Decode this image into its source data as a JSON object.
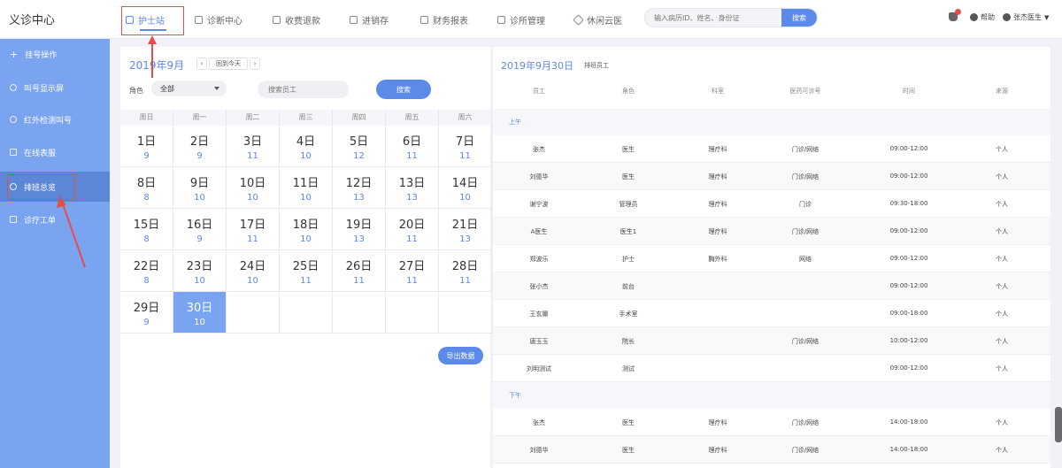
{
  "app": {
    "title": "义诊中心"
  },
  "nav": [
    {
      "label": "护士站",
      "icon": "shield-icon"
    },
    {
      "label": "诊断中心",
      "icon": "gear-icon"
    },
    {
      "label": "收费退款",
      "icon": "wallet-icon"
    },
    {
      "label": "进销存",
      "icon": "box-icon"
    },
    {
      "label": "财务报表",
      "icon": "chart-icon"
    },
    {
      "label": "诊所管理",
      "icon": "clinic-icon"
    },
    {
      "label": "休闲云医",
      "icon": "diamond-icon"
    }
  ],
  "search": {
    "placeholder": "输入病历ID、姓名、身份证",
    "button": "搜索"
  },
  "top_right": {
    "help": "帮助",
    "user": "张杰医生"
  },
  "sidebar": [
    {
      "label": "挂号操作"
    },
    {
      "label": "叫号显示屏"
    },
    {
      "label": "红外检测叫号"
    },
    {
      "label": "在线表服"
    },
    {
      "label": "排班总览"
    },
    {
      "label": "诊疗工单"
    }
  ],
  "calendar": {
    "month_title": "2019年9月",
    "prev": "‹",
    "today_btn": "回到今天",
    "next": "›",
    "role_label": "角色",
    "role_value": "全部",
    "name_placeholder": "搜索员工",
    "search_btn": "搜索",
    "weekdays": [
      "周日",
      "周一",
      "周二",
      "周三",
      "周四",
      "周五",
      "周六"
    ],
    "days": [
      {
        "day": "1日",
        "count": "9"
      },
      {
        "day": "2日",
        "count": "9"
      },
      {
        "day": "3日",
        "count": "11"
      },
      {
        "day": "4日",
        "count": "10"
      },
      {
        "day": "5日",
        "count": "12"
      },
      {
        "day": "6日",
        "count": "11"
      },
      {
        "day": "7日",
        "count": "11"
      },
      {
        "day": "8日",
        "count": "8"
      },
      {
        "day": "9日",
        "count": "10"
      },
      {
        "day": "10日",
        "count": "10"
      },
      {
        "day": "11日",
        "count": "10"
      },
      {
        "day": "12日",
        "count": "13"
      },
      {
        "day": "13日",
        "count": "13"
      },
      {
        "day": "14日",
        "count": "10"
      },
      {
        "day": "15日",
        "count": "8"
      },
      {
        "day": "16日",
        "count": "9"
      },
      {
        "day": "17日",
        "count": "11"
      },
      {
        "day": "18日",
        "count": "10"
      },
      {
        "day": "19日",
        "count": "13"
      },
      {
        "day": "20日",
        "count": "11"
      },
      {
        "day": "21日",
        "count": "13"
      },
      {
        "day": "22日",
        "count": "8"
      },
      {
        "day": "23日",
        "count": "10"
      },
      {
        "day": "24日",
        "count": "10"
      },
      {
        "day": "25日",
        "count": "11"
      },
      {
        "day": "26日",
        "count": "11"
      },
      {
        "day": "27日",
        "count": "11"
      },
      {
        "day": "28日",
        "count": "11"
      },
      {
        "day": "29日",
        "count": "9"
      },
      {
        "day": "30日",
        "count": "10"
      }
    ],
    "selected_day": "30日",
    "export_btn": "导出数据"
  },
  "schedule": {
    "title": "2019年9月30日",
    "subtitle": "排班员工",
    "columns": [
      "员工",
      "角色",
      "科室",
      "医药可诊号",
      "时间",
      "来源"
    ],
    "sections": [
      {
        "label": "上午",
        "rows": [
          [
            "张杰",
            "医生",
            "理疗科",
            "门诊/网络",
            "09:00-12:00",
            "个人"
          ],
          [
            "刘德华",
            "医生",
            "理疗科",
            "门诊/网络",
            "09:00-12:00",
            "个人"
          ],
          [
            "谢宁波",
            "管理员",
            "理疗科",
            "门诊",
            "09:30-18:00",
            "个人"
          ],
          [
            "A医生",
            "医生1",
            "理疗科",
            "门诊/网络",
            "09:00-12:00",
            "个人"
          ],
          [
            "郑波乐",
            "护士",
            "胸外科",
            "网络",
            "09:00-12:00",
            "个人"
          ],
          [
            "张小杰",
            "前台",
            "",
            "",
            "09:00-12:00",
            "个人"
          ],
          [
            "王玄娜",
            "手术室",
            "",
            "",
            "09:00-18:00",
            "个人"
          ],
          [
            "唐玉玉",
            "院长",
            "",
            "门诊/网络",
            "10:00-12:00",
            "个人"
          ],
          [
            "刘明测试",
            "测试",
            "",
            "",
            "09:00-12:00",
            "个人"
          ]
        ]
      },
      {
        "label": "下午",
        "rows": [
          [
            "张杰",
            "医生",
            "理疗科",
            "门诊/网络",
            "14:00-18:00",
            "个人"
          ],
          [
            "刘德华",
            "医生",
            "理疗科",
            "门诊/网络",
            "14:00-18:00",
            "个人"
          ]
        ]
      }
    ]
  },
  "colors": {
    "accent": "#5b8ae8",
    "sidebar": "#7aa3f0",
    "sidebar_active": "#5e86d6",
    "annotation": "#e84b4b"
  }
}
